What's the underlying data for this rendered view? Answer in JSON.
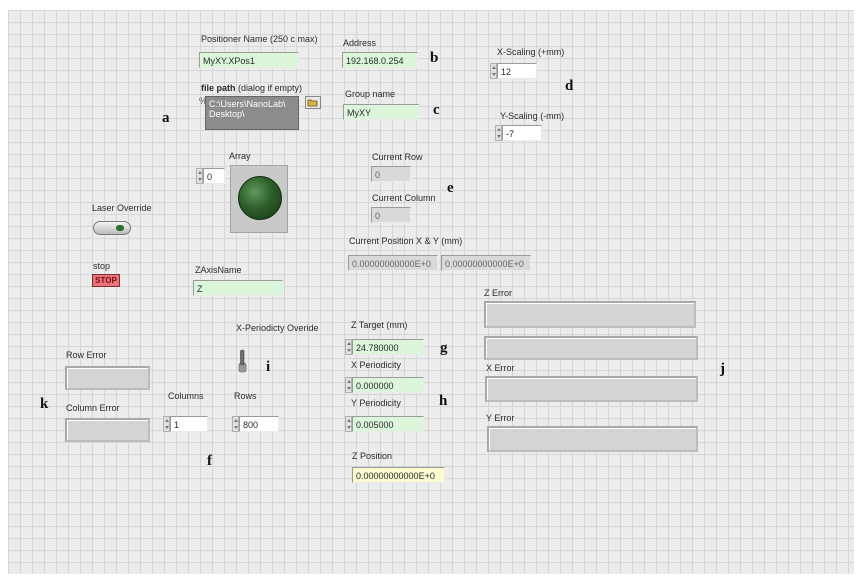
{
  "positioner": {
    "label": "Positioner Name (250 c max)",
    "value": "MyXY.XPos1"
  },
  "address": {
    "label": "Address",
    "value": "192.168.0.254"
  },
  "file_path": {
    "label_bold": "file path",
    "label_rest": " (dialog if empty)",
    "lines": [
      "C:\\Users\\NanoLab\\",
      "Desktop\\"
    ]
  },
  "group_name": {
    "label": "Group name",
    "value": "MyXY"
  },
  "x_scaling": {
    "label": "X-Scaling (+mm)",
    "value": "12"
  },
  "y_scaling": {
    "label": "Y-Scaling (-mm)",
    "value": "-7"
  },
  "array": {
    "label": "Array",
    "index": "0"
  },
  "current_row": {
    "label": "Current Row",
    "value": "0"
  },
  "current_column": {
    "label": "Current Column",
    "value": "0"
  },
  "laser_override": {
    "label": "Laser Override"
  },
  "stop": {
    "label": "stop",
    "button": "STOP"
  },
  "current_position": {
    "label": "Current Position X & Y (mm)",
    "x": "0.00000000000E+0",
    "y": "0.00000000000E+0"
  },
  "z_axis_name": {
    "label": "ZAxisName",
    "value": "Z"
  },
  "z_error": {
    "label": "Z Error"
  },
  "x_periodicity_override": {
    "label": "X-Periodicty Overide"
  },
  "z_target": {
    "label": "Z Target (mm)",
    "value": "24.780000"
  },
  "x_periodicity": {
    "label": "X Periodicity",
    "value": "0.000000"
  },
  "y_periodicity": {
    "label": "Y Periodicity",
    "value": "0.005000"
  },
  "z_position": {
    "label": "Z Position",
    "value": "0.00000000000E+0"
  },
  "row_error": {
    "label": "Row Error"
  },
  "column_error": {
    "label": "Column Error"
  },
  "columns": {
    "label": "Columns",
    "value": "1"
  },
  "rows": {
    "label": "Rows",
    "value": "800"
  },
  "x_error": {
    "label": "X Error"
  },
  "y_error": {
    "label": "Y Error"
  },
  "letters": {
    "a": "a",
    "b": "b",
    "c": "c",
    "d": "d",
    "e": "e",
    "f": "f",
    "g": "g",
    "h": "h",
    "i": "i",
    "j": "j",
    "k": "k"
  },
  "colors": {
    "led": "#2d5e2b",
    "control_fill": "#dcf6dc",
    "indicator_fill": "#d9d9d9",
    "stop_fill": "#e8757a"
  }
}
